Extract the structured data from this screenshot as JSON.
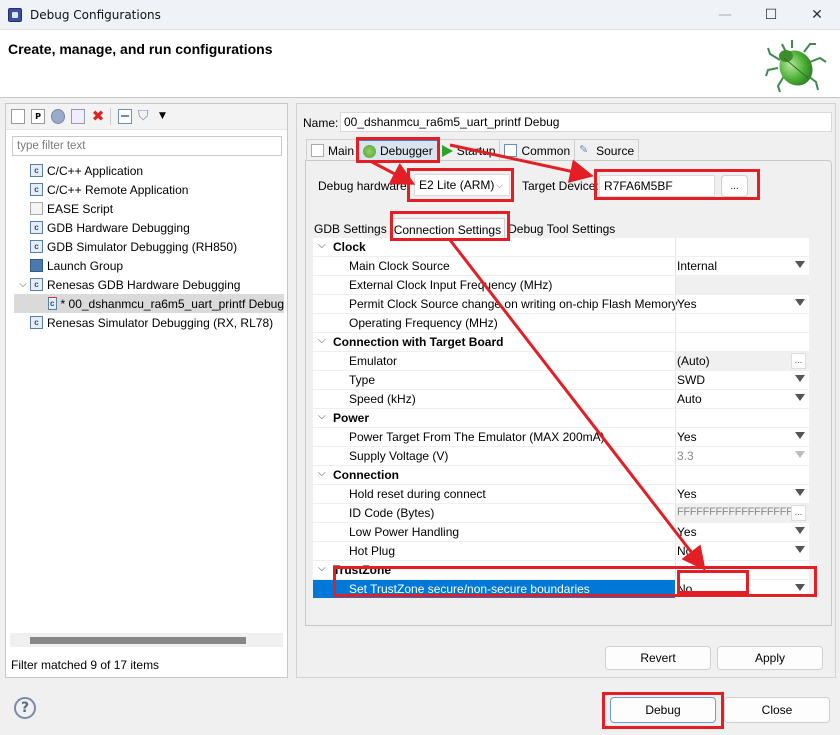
{
  "window": {
    "title": "Debug Configurations",
    "controls": {
      "minimize": "—",
      "maximize": "☐",
      "close": "✕"
    }
  },
  "header": {
    "heading": "Create, manage, and run configurations"
  },
  "sidebar": {
    "toolbar_icons": [
      "new-configuration-icon",
      "new-prototype-icon",
      "export-icon",
      "duplicate-icon",
      "delete-icon",
      "collapse-all-icon",
      "filter-icon",
      "view-menu-icon"
    ],
    "filter_placeholder": "type filter text",
    "tree": [
      {
        "label": "C/C++ Application",
        "level": 0
      },
      {
        "label": "C/C++ Remote Application",
        "level": 0
      },
      {
        "label": "EASE Script",
        "level": 0
      },
      {
        "label": "GDB Hardware Debugging",
        "level": 0
      },
      {
        "label": "GDB Simulator Debugging (RH850)",
        "level": 0
      },
      {
        "label": "Launch Group",
        "level": 0
      },
      {
        "label": "Renesas GDB Hardware Debugging",
        "level": 0,
        "expanded": true
      },
      {
        "label": "* 00_dshanmcu_ra6m5_uart_printf Debug",
        "level": 1,
        "selected": true
      },
      {
        "label": "Renesas Simulator Debugging (RX, RL78)",
        "level": 0
      }
    ],
    "filter_status": "Filter matched 9 of 17 items"
  },
  "config": {
    "name_label": "Name:",
    "name_value": "00_dshanmcu_ra6m5_uart_printf Debug",
    "tabs": [
      {
        "label": "Main",
        "icon": "main-tab-icon"
      },
      {
        "label": "Debugger",
        "icon": "debugger-bug-icon",
        "active": true
      },
      {
        "label": "Startup",
        "icon": "startup-play-icon"
      },
      {
        "label": "Common",
        "icon": "common-tab-icon"
      },
      {
        "label": "Source",
        "icon": "source-tab-icon"
      }
    ],
    "debug_hardware_label": "Debug hardware:",
    "debug_hardware_value": "E2 Lite (ARM)",
    "target_device_label": "Target Device:",
    "target_device_value": "R7FA6M5BF",
    "browse_label": "...",
    "subtabs": [
      {
        "label": "GDB Settings"
      },
      {
        "label": "Connection Settings",
        "active": true
      },
      {
        "label": "Debug Tool Settings"
      }
    ],
    "properties": [
      {
        "type": "category",
        "label": "Clock"
      },
      {
        "label": "Main Clock Source",
        "value": "Internal",
        "control": "dropdown"
      },
      {
        "label": "External Clock Input Frequency (MHz)",
        "value": "",
        "control": "none",
        "shaded": true
      },
      {
        "label": "Permit Clock Source change on writing on-chip Flash Memory",
        "value": "Yes",
        "control": "dropdown"
      },
      {
        "label": "Operating Frequency (MHz)",
        "value": "",
        "control": "none"
      },
      {
        "type": "category",
        "label": "Connection with Target Board"
      },
      {
        "label": "Emulator",
        "value": "(Auto)",
        "control": "browse",
        "shaded": true
      },
      {
        "label": "Type",
        "value": "SWD",
        "control": "dropdown"
      },
      {
        "label": "Speed (kHz)",
        "value": "Auto",
        "control": "dropdown"
      },
      {
        "type": "category",
        "label": "Power"
      },
      {
        "label": "Power Target From The Emulator (MAX 200mA)",
        "value": "Yes",
        "control": "dropdown"
      },
      {
        "label": "Supply Voltage (V)",
        "value": "3.3",
        "control": "dropdown",
        "disabled": true
      },
      {
        "type": "category",
        "label": "Connection"
      },
      {
        "label": "Hold reset during connect",
        "value": "Yes",
        "control": "dropdown"
      },
      {
        "label": "ID Code (Bytes)",
        "value": "FFFFFFFFFFFFFFFFFFFF",
        "control": "browse",
        "disabled": true,
        "shaded": true
      },
      {
        "label": "Low Power Handling",
        "value": "Yes",
        "control": "dropdown"
      },
      {
        "label": "Hot Plug",
        "value": "No",
        "control": "dropdown"
      },
      {
        "type": "category",
        "label": "TrustZone"
      },
      {
        "label": "Set TrustZone secure/non-secure boundaries",
        "value": "No",
        "control": "dropdown",
        "selected": true
      }
    ],
    "revert_label": "Revert",
    "apply_label": "Apply"
  },
  "footer": {
    "help_label": "?",
    "debug_label": "Debug",
    "close_label": "Close"
  },
  "annotations": {
    "highlight_color": "#e31e24"
  }
}
